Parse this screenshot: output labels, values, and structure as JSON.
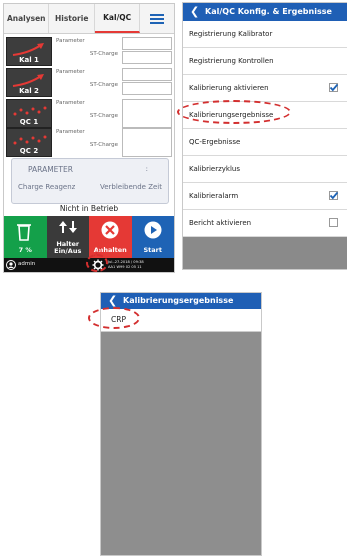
{
  "panel1": {
    "tabs": [
      "Analysen",
      "Historie",
      "Kal/QC"
    ],
    "slots": [
      {
        "label": "Kal 1",
        "parameter": "Parameter",
        "charge": "ST-Charge"
      },
      {
        "label": "Kal 2",
        "parameter": "Parameter",
        "charge": "ST-Charge"
      },
      {
        "label": "QC 1",
        "parameter": "Parameter",
        "charge": "ST-Charge"
      },
      {
        "label": "QC 2",
        "parameter": "Parameter",
        "charge": "ST-Charge"
      }
    ],
    "info": {
      "parameter": "PARAMETER",
      "colon": ":",
      "reagent": "Charge Reagenz",
      "remaining": "Verbleibende Zeit"
    },
    "status": "Nicht in Betrieb",
    "buttons": {
      "waste_pct": "7 %",
      "halter_l1": "Halter",
      "halter_l2": "Ein/Aus",
      "stop": "Anhalten",
      "start": "Start"
    },
    "statusbar": {
      "user": "admin",
      "date": "Jul.-27-2018 / 09:38",
      "serial": "AA1 W99 02 05 11"
    },
    "colors": {
      "green": "#14a04a",
      "red": "#e53935",
      "blue": "#1e63b5",
      "dark": "#3a3a3a"
    }
  },
  "panel2": {
    "title": "Kal/QC Konfig. & Ergebnisse",
    "items": [
      {
        "label": "Registrierung Kalibrator",
        "check": null
      },
      {
        "label": "Registrierung Kontrollen",
        "check": null
      },
      {
        "label": "Kalibrierung aktivieren",
        "check": "checked"
      },
      {
        "label": "Kalibrierungsergebnisse",
        "check": null
      },
      {
        "label": "QC-Ergebnisse",
        "check": null
      },
      {
        "label": "Kalibrierzyklus",
        "check": null
      },
      {
        "label": "Kalibrieralarm",
        "check": "checked"
      },
      {
        "label": "Bericht aktivieren",
        "check": "unchecked"
      }
    ]
  },
  "panel3": {
    "title": "Kalibrierungsergebnisse",
    "items": [
      "CRP"
    ]
  },
  "icons": {
    "back": "chevron-left-icon",
    "menu": "hamburger-menu-icon",
    "waste": "waste-bin-icon",
    "halter": "up-down-arrows-icon",
    "stop": "close-circle-icon",
    "start": "play-circle-icon",
    "settings": "gear-icon",
    "user": "user-icon"
  }
}
